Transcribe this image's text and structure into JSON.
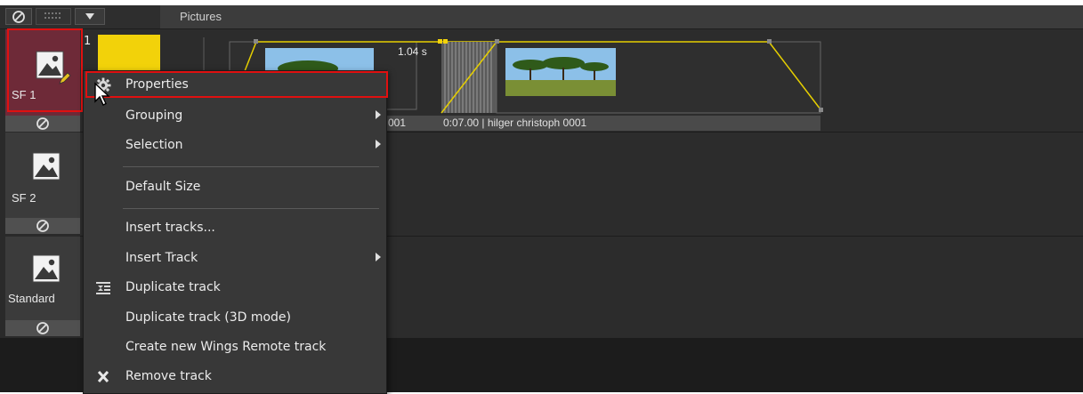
{
  "header": {
    "title": "Pictures",
    "mute_icon": "no-entry-icon",
    "grid_icon": "grid-icon",
    "dropdown_icon": "triangle-down-icon"
  },
  "tracks": [
    {
      "name": "SF  1",
      "number": "1",
      "mute_icon": "no-entry-icon"
    },
    {
      "name": "SF  2",
      "mute_icon": "no-entry-icon"
    },
    {
      "name": "Standard",
      "mute_icon": "no-entry-icon"
    }
  ],
  "timeline": {
    "transition_duration": "1.04 s",
    "clip_prev_label": "001",
    "clip_label": "0:07.00 | hilger christoph 0001"
  },
  "context_menu": {
    "items": [
      {
        "label": "Properties",
        "icon": "gear-icon"
      },
      {
        "label": "Grouping"
      },
      {
        "label": "Selection"
      },
      {
        "label": "Default Size"
      },
      {
        "label": "Insert tracks..."
      },
      {
        "label": "Insert Track"
      },
      {
        "label": "Duplicate track",
        "icon": "duplicate-track-icon"
      },
      {
        "label": "Duplicate track (3D mode)"
      },
      {
        "label": "Create new Wings Remote track"
      },
      {
        "label": "Remove track",
        "icon": "x-icon"
      }
    ]
  },
  "colors": {
    "highlight_border": "#e01010",
    "accent_yellow": "#f2d20a",
    "background": "#2a2a2a"
  }
}
